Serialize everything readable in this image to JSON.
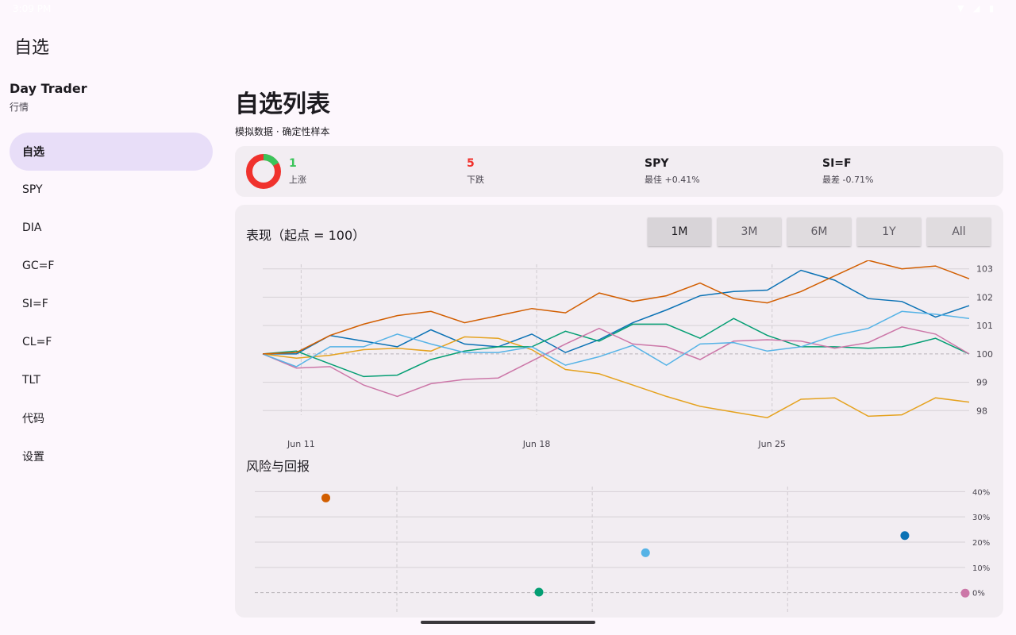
{
  "status": {
    "time": "3:09 PM",
    "icons": "▼ ◢ ▮"
  },
  "app_title": "自选",
  "brand": {
    "name": "Day Trader",
    "sub": "行情"
  },
  "nav": [
    {
      "label": "自选",
      "active": true
    },
    {
      "label": "SPY"
    },
    {
      "label": "DIA"
    },
    {
      "label": "GC=F"
    },
    {
      "label": "SI=F"
    },
    {
      "label": "CL=F"
    },
    {
      "label": "TLT"
    },
    {
      "label": "代码"
    },
    {
      "label": "设置"
    }
  ],
  "page": {
    "title": "自选列表",
    "subtitle": "模拟数据 · 确定性样本"
  },
  "summary": {
    "up": {
      "value": "1",
      "label": "上涨"
    },
    "down": {
      "value": "5",
      "label": "下跌"
    },
    "best": {
      "symbol": "SPY",
      "label": "最佳 +0.41%"
    },
    "worst": {
      "symbol": "SI=F",
      "label": "最差 -0.71%"
    },
    "donut": {
      "up_fraction": 0.1667,
      "up_color": "#3bc45a",
      "down_color": "#f0322d"
    }
  },
  "performance": {
    "title": "表现（起点 = 100）",
    "ranges": [
      "1M",
      "3M",
      "6M",
      "1Y",
      "All"
    ],
    "selected_range": "1M"
  },
  "risk": {
    "title": "风险与回报"
  },
  "chart_data": [
    {
      "type": "line",
      "ylim": [
        97.7,
        103.3
      ],
      "yticks": [
        "98",
        "99",
        "100",
        "101",
        "102",
        "103"
      ],
      "x_labels": [
        "Jun 11",
        "Jun 18",
        "Jun 25"
      ],
      "baseline": 100,
      "series": [
        {
          "name": "SPY",
          "color": "#0b72b5",
          "values": [
            100,
            100,
            100.65,
            100.45,
            100.25,
            100.85,
            100.35,
            100.25,
            100.7,
            100.05,
            100.5,
            101.1,
            101.55,
            102.05,
            102.2,
            102.25,
            102.95,
            102.6,
            101.95,
            101.85,
            101.3,
            101.7
          ]
        },
        {
          "name": "DIA",
          "color": "#e5a21e",
          "values": [
            100,
            99.85,
            99.95,
            100.15,
            100.2,
            100.1,
            100.6,
            100.55,
            100.15,
            99.45,
            99.3,
            98.9,
            98.5,
            98.15,
            97.95,
            97.75,
            98.4,
            98.45,
            97.8,
            97.85,
            98.45,
            98.3
          ]
        },
        {
          "name": "GC=F",
          "color": "#049e73",
          "values": [
            100,
            100.1,
            99.65,
            99.2,
            99.25,
            99.8,
            100.1,
            100.25,
            100.25,
            100.8,
            100.45,
            101.05,
            101.05,
            100.55,
            101.25,
            100.65,
            100.25,
            100.25,
            100.2,
            100.25,
            100.55,
            100
          ]
        },
        {
          "name": "SI=F",
          "color": "#cc77a8",
          "values": [
            100,
            99.5,
            99.55,
            98.9,
            98.5,
            98.95,
            99.1,
            99.15,
            99.75,
            100.35,
            100.9,
            100.35,
            100.25,
            99.8,
            100.45,
            100.5,
            100.45,
            100.2,
            100.4,
            100.95,
            100.7,
            100
          ]
        },
        {
          "name": "CL=F",
          "color": "#56b3e6",
          "values": [
            100,
            99.55,
            100.25,
            100.25,
            100.7,
            100.35,
            100.05,
            100.05,
            100.25,
            99.6,
            99.9,
            100.3,
            99.6,
            100.35,
            100.4,
            100.1,
            100.25,
            100.65,
            100.9,
            101.5,
            101.4,
            101.25
          ]
        },
        {
          "name": "TLT",
          "color": "#d25e00",
          "values": [
            100,
            100.05,
            100.65,
            101.05,
            101.35,
            101.5,
            101.1,
            101.35,
            101.6,
            101.45,
            102.15,
            101.85,
            102.05,
            102.5,
            101.95,
            101.8,
            102.2,
            102.75,
            103.3,
            103,
            103.1,
            102.65
          ]
        }
      ]
    },
    {
      "type": "scatter",
      "ylim": [
        -2,
        42
      ],
      "yticks": [
        "0%",
        "10%",
        "20%",
        "30%",
        "40%"
      ],
      "points": [
        {
          "color": "#d25e00",
          "x": 0.1,
          "y": 37.5
        },
        {
          "color": "#049e73",
          "x": 0.4,
          "y": 0.2
        },
        {
          "color": "#56b3e6",
          "x": 0.55,
          "y": 15.8
        },
        {
          "color": "#0b72b5",
          "x": 0.915,
          "y": 22.6
        },
        {
          "color": "#cc77a8",
          "x": 1.0,
          "y": -0.2
        }
      ]
    }
  ]
}
